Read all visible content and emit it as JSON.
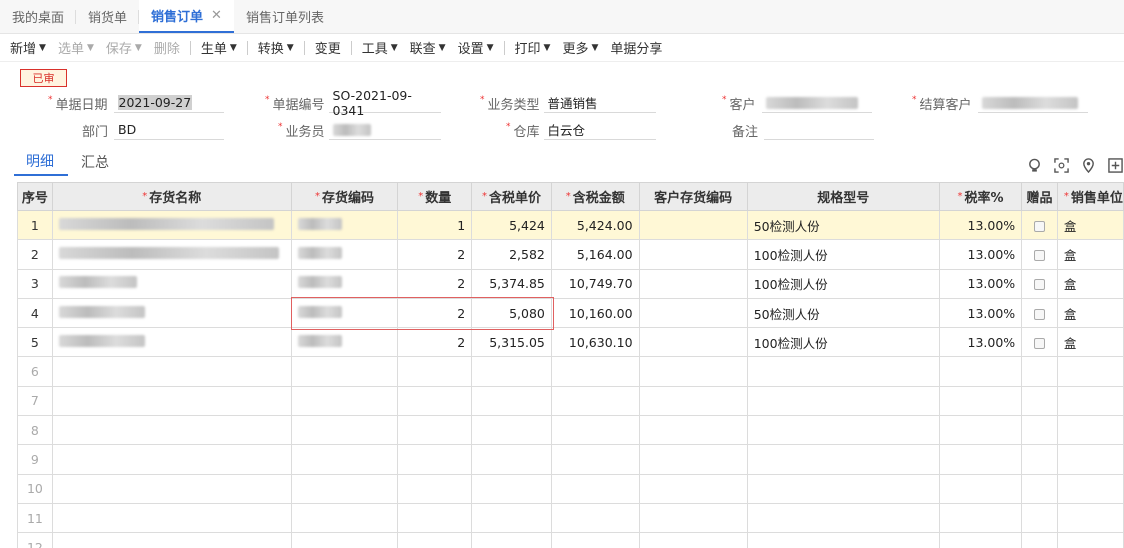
{
  "tabs": [
    {
      "label": "我的桌面"
    },
    {
      "label": "销货单"
    },
    {
      "label": "销售订单",
      "close": "✕"
    },
    {
      "label": "销售订单列表"
    }
  ],
  "toolbar": {
    "items": [
      "新增",
      "选单",
      "保存",
      "删除",
      "生单",
      "转换",
      "变更",
      "工具",
      "联查",
      "设置",
      "打印",
      "更多",
      "单据分享"
    ]
  },
  "status": "已审",
  "form": {
    "date_label": "单据日期",
    "date_value": "2021-09-27",
    "no_label": "单据编号",
    "no_value": "SO-2021-09-0341",
    "biz_label": "业务类型",
    "biz_value": "普通销售",
    "customer_label": "客户",
    "settle_label": "结算客户",
    "dept_label": "部门",
    "dept_value": "BD",
    "staff_label": "业务员",
    "wh_label": "仓库",
    "wh_value": "白云仓",
    "remark_label": "备注"
  },
  "subtabs": [
    "明细",
    "汇总"
  ],
  "grid": {
    "headers": [
      "序号",
      "存货名称",
      "存货编码",
      "数量",
      "含税单价",
      "含税金额",
      "客户存货编码",
      "规格型号",
      "税率%",
      "赠品",
      "销售单位"
    ],
    "rows": [
      {
        "idx": "1",
        "qty": "1",
        "price": "5,424",
        "amount": "5,424.00",
        "spec": "50检测人份",
        "tax": "13.00%",
        "unit": "盒"
      },
      {
        "idx": "2",
        "qty": "2",
        "price": "2,582",
        "amount": "5,164.00",
        "spec": "100检测人份",
        "tax": "13.00%",
        "unit": "盒"
      },
      {
        "idx": "3",
        "qty": "2",
        "price": "5,374.85",
        "amount": "10,749.70",
        "spec": "100检测人份",
        "tax": "13.00%",
        "unit": "盒"
      },
      {
        "idx": "4",
        "qty": "2",
        "price": "5,080",
        "amount": "10,160.00",
        "spec": "50检测人份",
        "tax": "13.00%",
        "unit": "盒"
      },
      {
        "idx": "5",
        "qty": "2",
        "price": "5,315.05",
        "amount": "10,630.10",
        "spec": "100检测人份",
        "tax": "13.00%",
        "unit": "盒"
      }
    ],
    "empty_rows": [
      "6",
      "7",
      "8",
      "9",
      "10",
      "11",
      "12"
    ]
  },
  "colors": {
    "accent": "#2f6fd6",
    "required": "#e33333",
    "selected_row": "#fff8d6",
    "stamp": "#d9312b"
  }
}
